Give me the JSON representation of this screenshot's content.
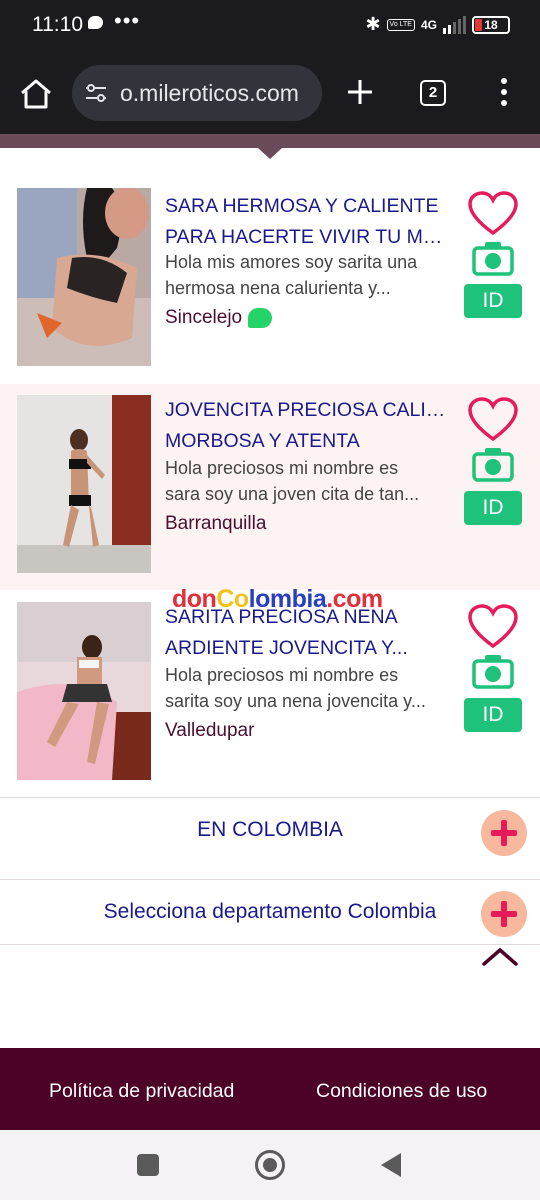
{
  "status_bar": {
    "time": "11:10",
    "dots": "•••",
    "network": "4G",
    "volte": "Vo LTE",
    "battery": "18"
  },
  "browser": {
    "url": "o.mileroticos.com",
    "tab_count": "2"
  },
  "listings": [
    {
      "title_line1": "SARA HERMOSA Y CALIENTE",
      "title_line2": "PARA HACERTE VIVIR TU MEJ...",
      "desc_line1": "Hola mis amores soy sarita una",
      "desc_line2": "hermosa nena calurienta y...",
      "city": "Sincelejo",
      "id_label": "ID",
      "has_whatsapp": true
    },
    {
      "title_line1": "JOVENCITA PRECIOSA CALIENTE",
      "title_line2": "MORBOSA Y ATENTA",
      "desc_line1": "Hola preciosos mi nombre es",
      "desc_line2": "sara soy una joven cita de tan...",
      "city": "Barranquilla",
      "id_label": "ID",
      "has_whatsapp": false
    },
    {
      "title_line1": "SARITA PRECIOSA NENA",
      "title_line2": "ARDIENTE JOVENCITA Y...",
      "desc_line1": "Hola preciosos mi nombre es",
      "desc_line2": "sarita soy una nena jovencita y...",
      "city": "Valledupar",
      "id_label": "ID",
      "has_whatsapp": false
    }
  ],
  "watermark": {
    "part1": "don",
    "part2": "Co",
    "part3": "lombia",
    "part4": ".com"
  },
  "sections": {
    "colombia": "EN COLOMBIA",
    "departamento": "Selecciona departamento Colombia"
  },
  "footer": {
    "privacy": "Política de privacidad",
    "terms": "Condiciones de uso"
  },
  "colors": {
    "title_blue": "#1a1a8c",
    "id_green": "#1ec27a",
    "heart_pink": "#e51b5c",
    "footer_maroon": "#4c0127"
  },
  "icons": {
    "heart": "heart-icon",
    "camera": "camera-icon",
    "plus": "plus-icon",
    "chevron_up": "chevron-up-icon"
  }
}
